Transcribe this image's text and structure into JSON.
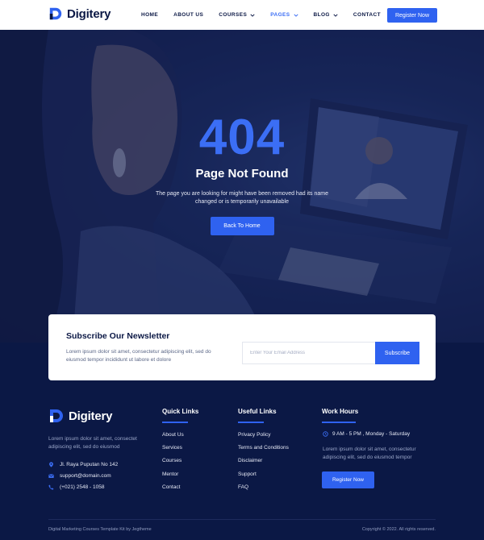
{
  "brand": {
    "name": "Digitery",
    "accent": "#2f62f0",
    "dark": "#0b1845"
  },
  "nav": {
    "items": [
      {
        "label": "HOME",
        "has_dropdown": false,
        "active": false
      },
      {
        "label": "ABOUT US",
        "has_dropdown": false,
        "active": false
      },
      {
        "label": "COURSES",
        "has_dropdown": true,
        "active": false
      },
      {
        "label": "PAGES",
        "has_dropdown": true,
        "active": true
      },
      {
        "label": "BLOG",
        "has_dropdown": true,
        "active": false
      },
      {
        "label": "CONTACT",
        "has_dropdown": false,
        "active": false
      }
    ],
    "register_label": "Register Now"
  },
  "hero": {
    "code": "404",
    "title": "Page Not Found",
    "description": "The page you are looking for might have been removed had its name changed or is temporarily unavailable",
    "button_label": "Back To Home"
  },
  "newsletter": {
    "title": "Subscribe Our Newsletter",
    "text": "Lorem ipsum dolor sit amet, consectetur adipiscing elit, sed do eiusmod tempor incididunt ut labore et dolore",
    "input_placeholder": "Enter Your Email Address",
    "button_label": "Subscribe"
  },
  "footer": {
    "about": "Lorem ipsum dolor sit amet, consectet adipiscing elit, sed do eiusmod",
    "contacts": [
      {
        "icon": "location-pin-icon",
        "text": "Jl. Raya Puputan No 142"
      },
      {
        "icon": "mail-icon",
        "text": "support@domain.com"
      },
      {
        "icon": "phone-icon",
        "text": "(+021) 2548 - 1058"
      }
    ],
    "quick_links": {
      "title": "Quick Links",
      "items": [
        "About Us",
        "Services",
        "Courses",
        "Mentor",
        "Contact"
      ]
    },
    "useful_links": {
      "title": "Useful Links",
      "items": [
        "Privacy Policy",
        "Terms and Conditions",
        "Disclaimer",
        "Support",
        "FAQ"
      ]
    },
    "work_hours": {
      "title": "Work Hours",
      "hours": "9 AM - 5 PM , Monday - Saturday",
      "text": "Lorem ipsum dolor sit amet, consectetur adipiscing elit, sed do eiusmod tempor",
      "button_label": "Register Now"
    },
    "bottom_left": "Digital Marketing Courses Template Kit by Jegtheme",
    "bottom_right": "Copyright © 2022. All rights reserved."
  }
}
